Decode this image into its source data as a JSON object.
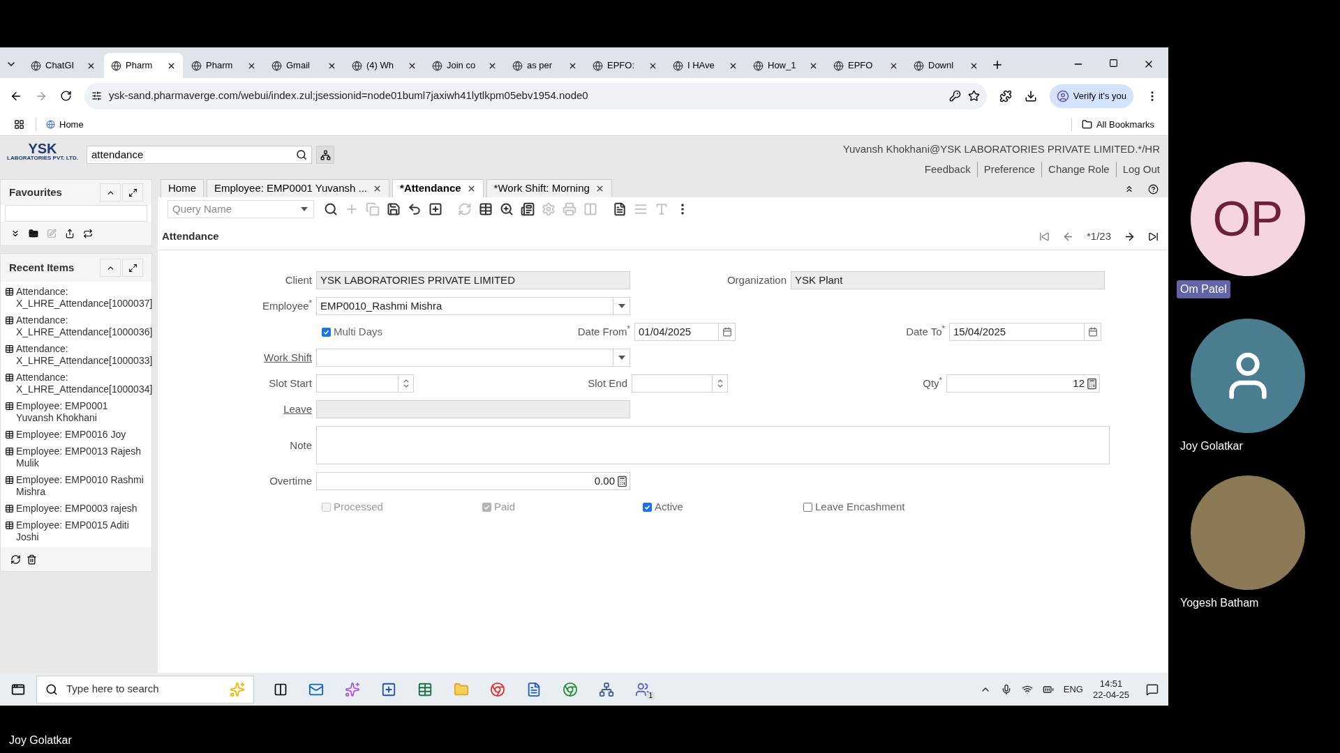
{
  "browser": {
    "tabs": [
      {
        "title": "ChatGI",
        "selected": false
      },
      {
        "title": "Pharm",
        "selected": true
      },
      {
        "title": "Pharm",
        "selected": false
      },
      {
        "title": "Gmail",
        "selected": false
      },
      {
        "title": "(4) Wh",
        "selected": false
      },
      {
        "title": "Join co",
        "selected": false
      },
      {
        "title": "as per",
        "selected": false
      },
      {
        "title": "EPFO:",
        "selected": false
      },
      {
        "title": "I HAve",
        "selected": false
      },
      {
        "title": "How_1",
        "selected": false
      },
      {
        "title": "EPFO",
        "selected": false
      },
      {
        "title": "Downl",
        "selected": false
      }
    ],
    "url": "ysk-sand.pharmaverge.com/webui/index.zul;jsessionid=node01buml7jaxiwh41lytlkpm05ebv1954.node0",
    "verify_button": "Verify it's you",
    "bookmarks": [
      "Home"
    ],
    "all_bookmarks": "All Bookmarks"
  },
  "app": {
    "logo": {
      "name": "YSK",
      "subtitle": "LABORATORIES PVT. LTD."
    },
    "search": {
      "value": "attendance"
    },
    "user": "Yuvansh Khokhani@YSK LABORATORIES PRIVATE LIMITED.*/HR",
    "links": [
      "Feedback",
      "Preference",
      "Change Role",
      "Log Out"
    ],
    "favourites": {
      "title": "Favourites"
    },
    "recent": {
      "title": "Recent Items",
      "items": [
        "Attendance: X_LHRE_Attendance[1000037]",
        "Attendance: X_LHRE_Attendance[1000036]",
        "Attendance: X_LHRE_Attendance[1000033]",
        "Attendance: X_LHRE_Attendance[1000034]",
        "Employee: EMP0001 Yuvansh Khokhani",
        "Employee: EMP0016 Joy",
        "Employee: EMP0013 Rajesh Mulik",
        "Employee: EMP0010 Rashmi Mishra",
        "Employee: EMP0003 rajesh",
        "Employee: EMP0015 Aditi Joshi"
      ]
    },
    "tabs": [
      {
        "title": "Home",
        "selected": false,
        "closable": false
      },
      {
        "title": "Employee: EMP0001 Yuvansh ...",
        "selected": false,
        "closable": true
      },
      {
        "title": "*Attendance",
        "selected": true,
        "closable": true
      },
      {
        "title": "*Work Shift: Morning",
        "selected": false,
        "closable": true
      }
    ],
    "query": {
      "placeholder": "Query Name"
    },
    "toolbar": [
      {
        "disabled": false
      },
      {
        "disabled": true
      },
      {
        "disabled": true
      },
      {
        "disabled": false
      },
      {
        "disabled": false
      },
      {
        "disabled": false
      },
      {
        "disabled": true
      },
      {
        "disabled": false
      },
      {
        "disabled": false
      },
      {
        "disabled": false
      },
      {
        "disabled": true
      },
      {
        "disabled": true
      },
      {
        "disabled": true
      },
      {
        "disabled": false
      },
      {
        "disabled": true
      },
      {
        "disabled": true
      },
      {
        "disabled": false
      }
    ],
    "breadcrumb": "Attendance",
    "record_nav": "*1/23",
    "form": {
      "rows": [
        {
          "fields": [
            {
              "kind": "text",
              "label": "Client",
              "value": "YSK LABORATORIES PRIVATE LIMITED",
              "readonly": true
            },
            {
              "kind": "text",
              "label": "Organization",
              "value": "YSK Plant",
              "readonly": true
            }
          ]
        },
        {
          "fields": [
            {
              "kind": "select",
              "label": "Employee$^{*}$",
              "value": "EMP0010_Rashmi Mishra",
              "link": false
            }
          ]
        },
        {
          "fields": [
            {
              "kind": "checkbox",
              "label": "Multi Days",
              "checked": true,
              "disabled": false
            },
            {
              "kind": "date",
              "label": "Date From$^{*}$",
              "value": "01/04/2025"
            },
            {
              "kind": "date",
              "label": "Date To$^{*}$",
              "value": "15/04/2025"
            }
          ]
        },
        {
          "fields": [
            {
              "kind": "select",
              "label": "Work Shift",
              "link": true
            }
          ]
        },
        {
          "fields": [
            {
              "kind": "spinner",
              "label": "Slot Start"
            },
            {
              "kind": "spinner",
              "label": "Slot End"
            },
            {
              "kind": "number",
              "label": "Qty$^{*}$",
              "value": "12"
            }
          ]
        },
        {
          "fields": [
            {
              "kind": "text",
              "label": "Leave",
              "readonly": true,
              "link": true
            }
          ]
        },
        {
          "fields": [
            {
              "kind": "textarea",
              "label": "Note"
            }
          ]
        },
        {
          "fields": [
            {
              "kind": "number",
              "label": "Overtime",
              "value": "0.00"
            }
          ]
        },
        {
          "fields": [
            {
              "kind": "checkbox",
              "label": "Processed",
              "checked": false,
              "disabled": true
            },
            {
              "kind": "checkbox",
              "label": "Paid",
              "checked": true,
              "disabled": true
            },
            {
              "kind": "checkbox",
              "label": "Active",
              "checked": true,
              "disabled": false
            },
            {
              "kind": "checkbox",
              "label": "Leave Encashment",
              "checked": false,
              "disabled": false
            }
          ]
        }
      ]
    }
  },
  "taskbar": {
    "search_placeholder": "Type here to search",
    "badge": "1",
    "language": "ENG",
    "time": "14:51",
    "date": "22-04-25"
  },
  "participants": [
    {
      "kind": "initials",
      "initials": "OP",
      "name": "Om Patel",
      "highlighted": true
    },
    {
      "kind": "generic",
      "name": "Joy Golatkar",
      "highlighted": false
    },
    {
      "kind": "photo",
      "name": "Yogesh Batham",
      "highlighted": false
    }
  ],
  "speaker": "Joy Golatkar"
}
